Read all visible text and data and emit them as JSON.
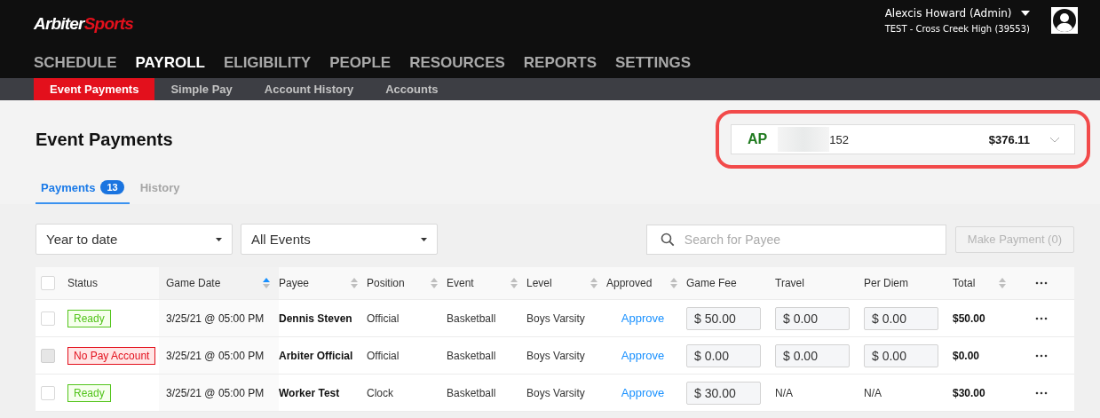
{
  "brand": {
    "part_1": "Arbiter",
    "part_2": "Sports"
  },
  "user": {
    "name": "Alexcis Howard (Admin)",
    "org": "TEST - Cross Creek High (39553)"
  },
  "main_nav": [
    {
      "label": "SCHEDULE",
      "selected": false
    },
    {
      "label": "PAYROLL",
      "selected": true
    },
    {
      "label": "ELIGIBILITY",
      "selected": false
    },
    {
      "label": "PEOPLE",
      "selected": false
    },
    {
      "label": "RESOURCES",
      "selected": false
    },
    {
      "label": "REPORTS",
      "selected": false
    },
    {
      "label": "SETTINGS",
      "selected": false
    }
  ],
  "sub_nav": [
    {
      "label": "Event Payments",
      "selected": true
    },
    {
      "label": "Simple Pay",
      "selected": false
    },
    {
      "label": "Account History",
      "selected": false
    },
    {
      "label": "Accounts",
      "selected": false
    }
  ],
  "page_title": "Event Payments",
  "account": {
    "code": "AP",
    "number_suffix": "152",
    "balance": "$376.11",
    "highlighted": true
  },
  "tabs": [
    {
      "label": "Payments",
      "badge": "13",
      "selected": true
    },
    {
      "label": "History",
      "selected": false
    }
  ],
  "filters": [
    {
      "value": "Year to date"
    },
    {
      "value": "All Events"
    }
  ],
  "search": {
    "placeholder": "Search for Payee"
  },
  "make_payment": {
    "label": "Make Payment (0)",
    "disabled": true
  },
  "table": {
    "select_all_checked": false,
    "columns": [
      {
        "label": "Status",
        "sortable": false
      },
      {
        "label": "Game Date",
        "sortable": true,
        "sorted": true
      },
      {
        "label": "Payee",
        "sortable": true,
        "sorted": false
      },
      {
        "label": "Position",
        "sortable": true,
        "sorted": false
      },
      {
        "label": "Event",
        "sortable": true,
        "sorted": false
      },
      {
        "label": "Level",
        "sortable": true,
        "sorted": false
      },
      {
        "label": "Approved",
        "sortable": true,
        "sorted": false
      },
      {
        "label": "Game Fee",
        "sortable": false
      },
      {
        "label": "Travel",
        "sortable": false
      },
      {
        "label": "Per Diem",
        "sortable": false
      },
      {
        "label": "Total",
        "sortable": true,
        "sorted": false
      }
    ],
    "rows": [
      {
        "checked": false,
        "disabled": false,
        "status": {
          "label": "Ready",
          "kind": "ok"
        },
        "game_date": "3/25/21 @ 05:00 PM",
        "payee": "Dennis Steven",
        "position": "Official",
        "event": "Basketball",
        "level": "Boys Varsity",
        "approved": "Approve",
        "game_fee": {
          "kind": "field",
          "value": "$ 50.00"
        },
        "travel": {
          "kind": "field",
          "value": "$ 0.00"
        },
        "per_diem": {
          "kind": "field",
          "value": "$ 0.00"
        },
        "total": "$50.00"
      },
      {
        "checked": false,
        "disabled": true,
        "status": {
          "label": "No Pay Account",
          "kind": "error"
        },
        "game_date": "3/25/21 @ 05:00 PM",
        "payee": "Arbiter Official",
        "position": "Official",
        "event": "Basketball",
        "level": "Boys Varsity",
        "approved": "Approve",
        "game_fee": {
          "kind": "field",
          "value": "$ 0.00"
        },
        "travel": {
          "kind": "field",
          "value": "$ 0.00"
        },
        "per_diem": {
          "kind": "field",
          "value": "$ 0.00"
        },
        "total": "$0.00"
      },
      {
        "checked": false,
        "disabled": false,
        "status": {
          "label": "Ready",
          "kind": "ok"
        },
        "game_date": "3/25/21 @ 05:00 PM",
        "payee": "Worker Test",
        "position": "Clock",
        "event": "Basketball",
        "level": "Boys Varsity",
        "approved": "Approve",
        "game_fee": {
          "kind": "field",
          "value": "$ 30.00"
        },
        "travel": {
          "kind": "text",
          "value": "N/A"
        },
        "per_diem": {
          "kind": "text",
          "value": "N/A"
        },
        "total": "$30.00"
      }
    ]
  }
}
